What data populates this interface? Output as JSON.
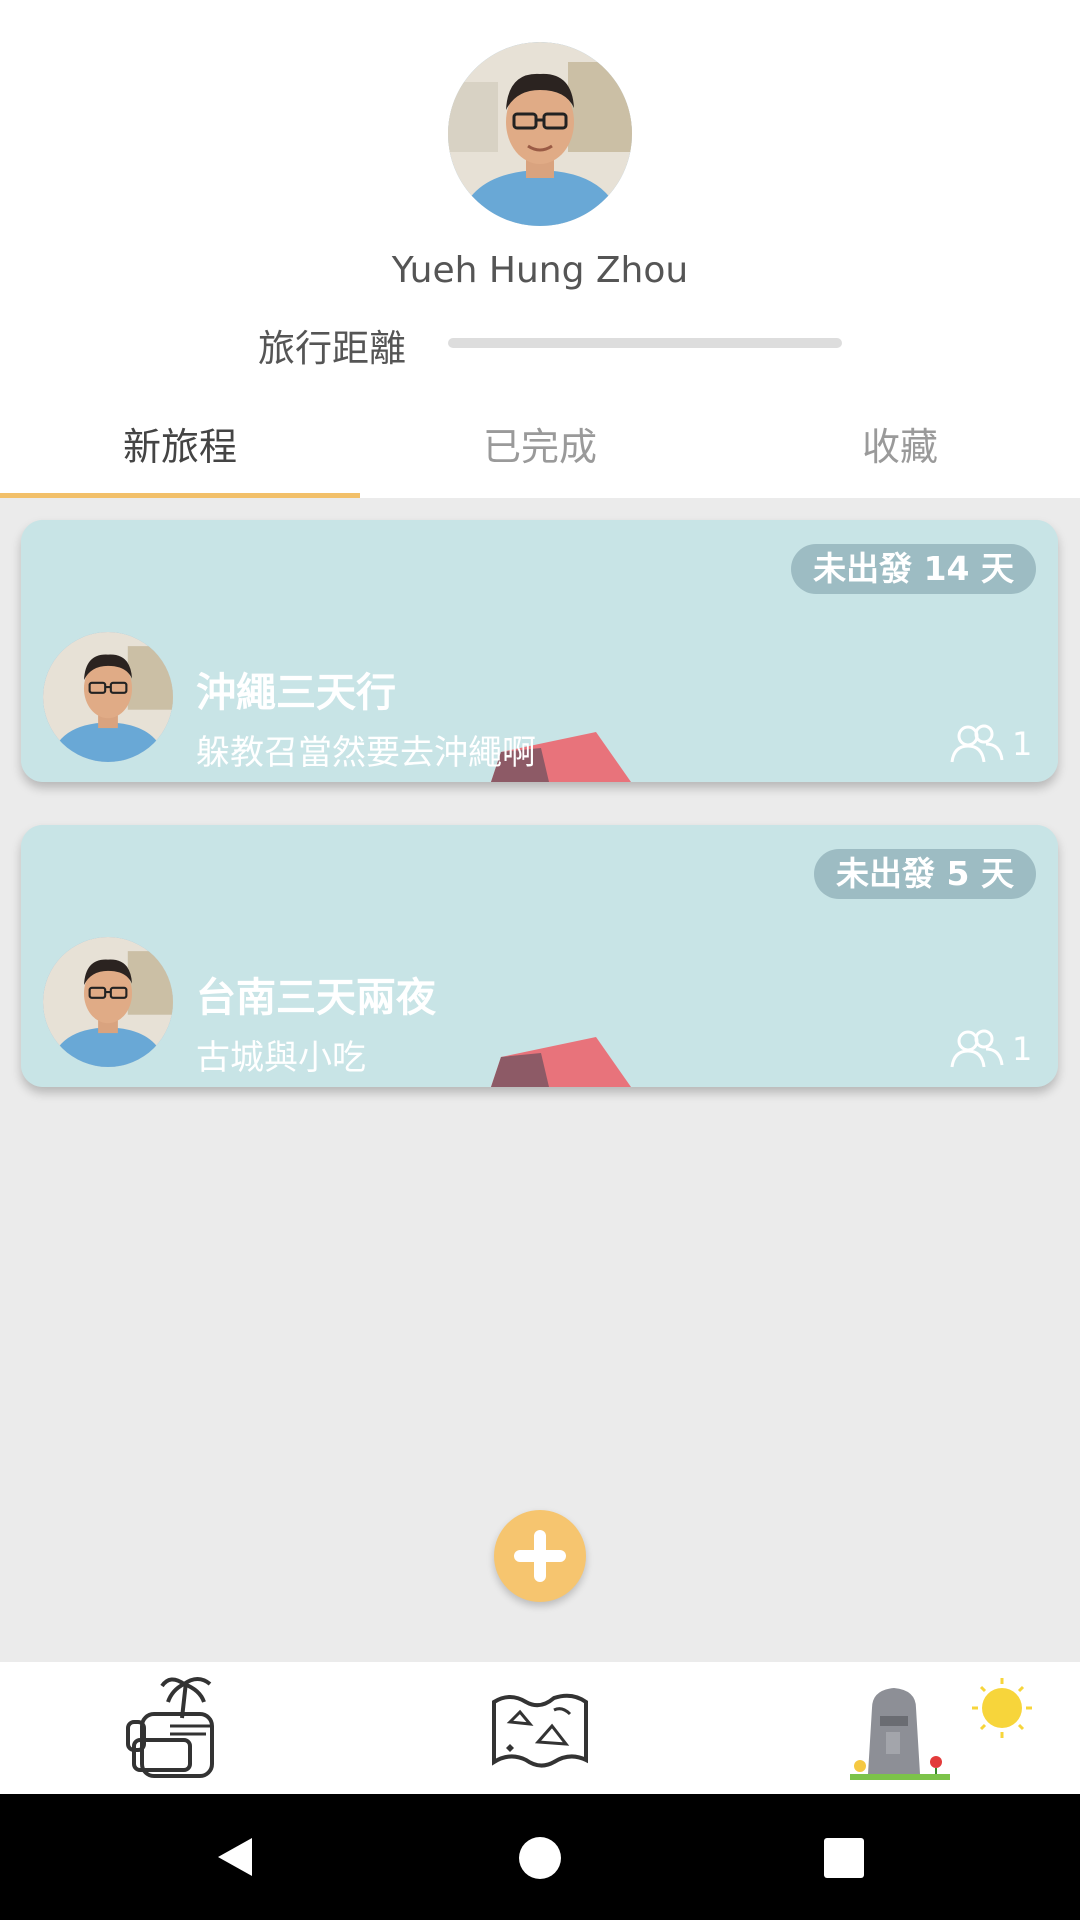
{
  "profile": {
    "name": "Yueh Hung Zhou",
    "distance_label": "旅行距離"
  },
  "tabs": [
    {
      "label": "新旅程",
      "active": true
    },
    {
      "label": "已完成",
      "active": false
    },
    {
      "label": "收藏",
      "active": false
    }
  ],
  "trips": [
    {
      "badge": "未出發 14 天",
      "title": "沖繩三天行",
      "subtitle": "躲教召當然要去沖繩啊",
      "members": "1"
    },
    {
      "badge": "未出發 5 天",
      "title": "台南三天兩夜",
      "subtitle": "古城與小吃",
      "members": "1"
    }
  ],
  "colors": {
    "accent": "#f2c06a",
    "card_bg": "#c8e4e6",
    "badge_bg": "#9dbcc3",
    "fab": "#f6c56f"
  },
  "icons": {
    "fab": "plus-icon",
    "nav": [
      "backpack-icon",
      "map-icon",
      "moai-icon"
    ],
    "system": [
      "back-icon",
      "home-icon",
      "recents-icon"
    ]
  }
}
